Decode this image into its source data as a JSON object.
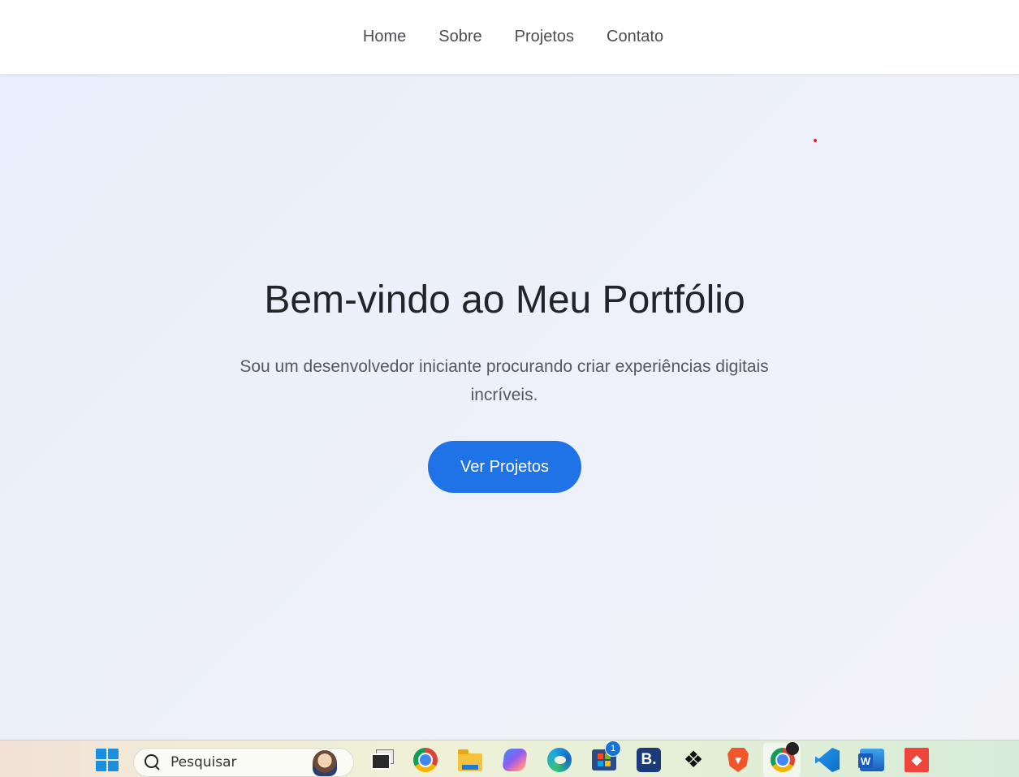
{
  "nav": {
    "items": [
      {
        "label": "Home"
      },
      {
        "label": "Sobre"
      },
      {
        "label": "Projetos"
      },
      {
        "label": "Contato"
      }
    ]
  },
  "hero": {
    "title": "Bem-vindo ao Meu Portfólio",
    "subtitle": "Sou um desenvolvedor iniciante procurando criar experiências digitais incríveis.",
    "cta_label": "Ver Projetos",
    "cta_color": "#1f73e6"
  },
  "taskbar": {
    "search_placeholder": "Pesquisar",
    "store_badge": "1",
    "booking_letter": "B.",
    "icons": [
      "windows-start-icon",
      "search-icon",
      "task-view-icon",
      "chrome-icon",
      "file-explorer-icon",
      "copilot-icon",
      "edge-icon",
      "microsoft-store-icon",
      "booking-icon",
      "dropbox-icon",
      "brave-icon",
      "chrome-icon",
      "vscode-icon",
      "word-icon",
      "anydesk-icon"
    ]
  }
}
